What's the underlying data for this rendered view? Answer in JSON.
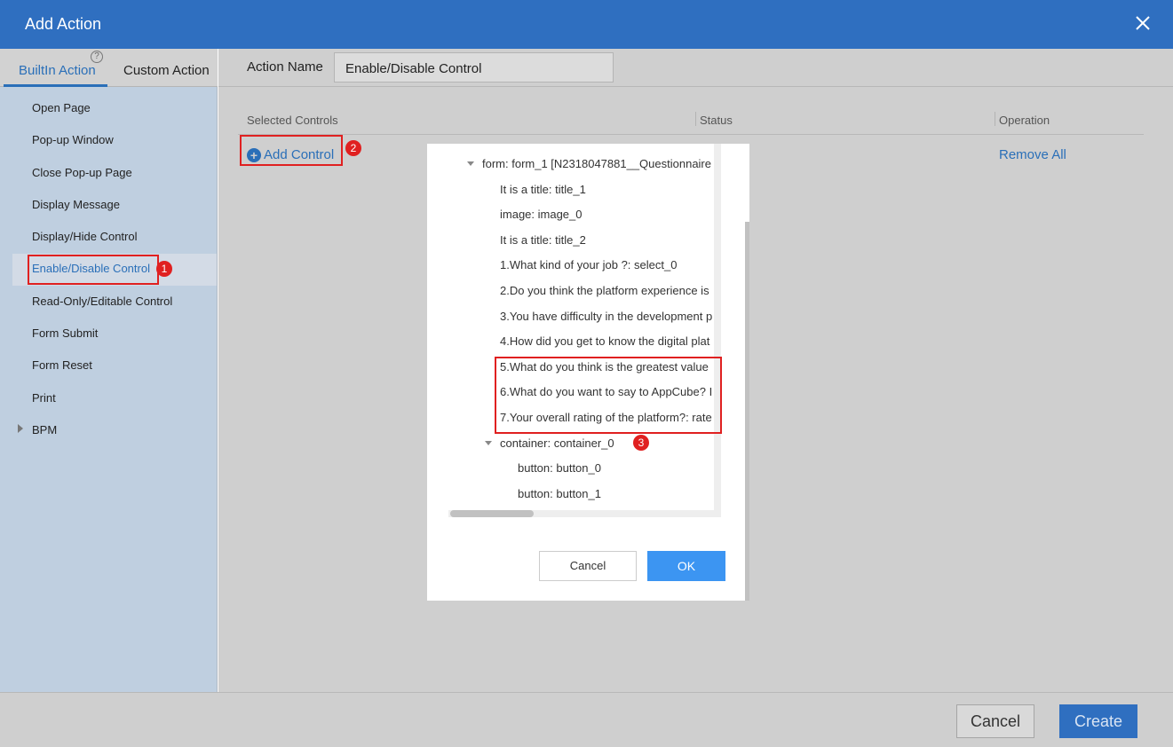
{
  "window": {
    "title": "Add Action"
  },
  "tabs": {
    "builtin": "BuiltIn Action",
    "custom": "Custom Action",
    "help": "?"
  },
  "menu": {
    "items": [
      {
        "label": "Open Page"
      },
      {
        "label": "Pop-up Window"
      },
      {
        "label": "Close Pop-up Page"
      },
      {
        "label": "Display Message"
      },
      {
        "label": "Display/Hide Control"
      },
      {
        "label": "Enable/Disable Control",
        "selected": true
      },
      {
        "label": "Read-Only/Editable Control"
      },
      {
        "label": "Form Submit"
      },
      {
        "label": "Form Reset"
      },
      {
        "label": "Print"
      },
      {
        "label": "BPM",
        "expandable": true
      }
    ]
  },
  "action_name": {
    "label": "Action Name",
    "value": "Enable/Disable Control"
  },
  "table": {
    "headers": [
      "Selected Controls",
      "Status",
      "Operation"
    ],
    "add_control": "Add Control",
    "remove_all": "Remove All"
  },
  "annotations": {
    "badge1": "1",
    "badge2": "2",
    "badge3": "3"
  },
  "tree": {
    "items": [
      {
        "label": "form: form_1 [N2318047881__Questionnaire",
        "expanded": true
      },
      {
        "label": "It is a title: title_1"
      },
      {
        "label": "image: image_0"
      },
      {
        "label": "It is a title: title_2"
      },
      {
        "label": "1.What kind of your job ?: select_0"
      },
      {
        "label": "2.Do you think the platform experience is"
      },
      {
        "label": "3.You have difficulty in the development p"
      },
      {
        "label": "4.How did you get to know the digital plat"
      },
      {
        "label": "5.What do you think is the greatest value"
      },
      {
        "label": "6.What do you want to say to AppCube? I"
      },
      {
        "label": "7.Your overall rating of the platform?: rate"
      },
      {
        "label": "container: container_0",
        "expanded": true
      },
      {
        "label": "button: button_0"
      },
      {
        "label": "button: button_1"
      }
    ]
  },
  "modal": {
    "cancel": "Cancel",
    "ok": "OK"
  },
  "footer": {
    "cancel": "Cancel",
    "create": "Create"
  },
  "colors": {
    "brand": "#2f6fc0",
    "link": "#2a6fb8",
    "ok": "#3c95f2",
    "annotation": "#e02020"
  }
}
